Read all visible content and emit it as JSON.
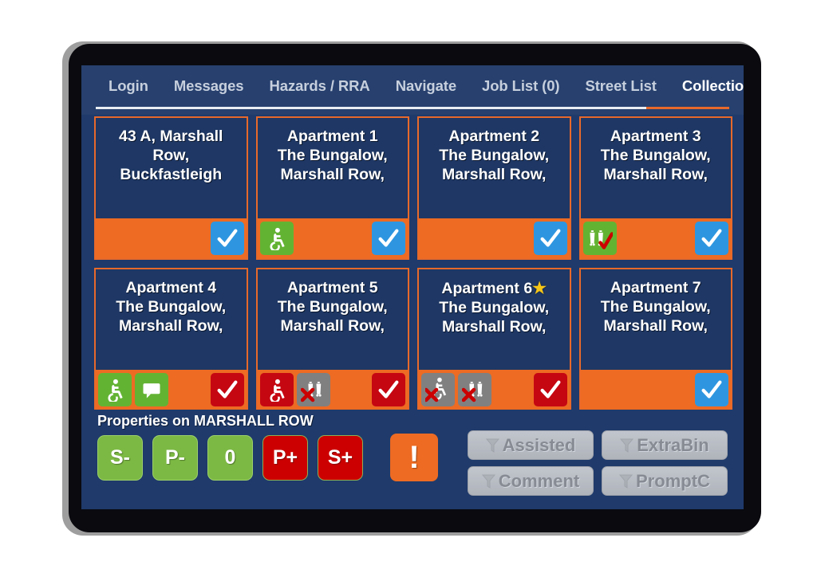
{
  "app": {
    "screen_name": "Collections"
  },
  "nav": {
    "tabs": [
      {
        "label": "Login",
        "active": false
      },
      {
        "label": "Messages",
        "active": false
      },
      {
        "label": "Hazards / RRA",
        "active": false
      },
      {
        "label": "Navigate",
        "active": false
      },
      {
        "label": "Job List (0)",
        "active": false
      },
      {
        "label": "Street List",
        "active": false
      },
      {
        "label": "Collections",
        "active": true
      }
    ]
  },
  "cards": [
    {
      "title": "43 A, Marshall\nRow,\nBuckfastleigh",
      "star": false,
      "icons": [],
      "check": {
        "name": "check-icon",
        "color": "blue"
      }
    },
    {
      "title": "Apartment 1\nThe Bungalow,\nMarshall Row,",
      "star": false,
      "icons": [
        {
          "name": "wheelchair-icon",
          "color": "green"
        }
      ],
      "check": {
        "name": "check-icon",
        "color": "blue"
      }
    },
    {
      "title": "Apartment 2\nThe Bungalow,\nMarshall Row,",
      "star": false,
      "icons": [],
      "check": {
        "name": "check-icon",
        "color": "blue"
      }
    },
    {
      "title": "Apartment 3\nThe Bungalow,\nMarshall Row,",
      "star": false,
      "icons": [
        {
          "name": "extra-bin-icon",
          "color": "green"
        }
      ],
      "check": {
        "name": "check-icon",
        "color": "blue"
      }
    },
    {
      "title": "Apartment 4\nThe Bungalow,\nMarshall Row,",
      "star": false,
      "icons": [
        {
          "name": "wheelchair-icon",
          "color": "green"
        },
        {
          "name": "comment-icon",
          "color": "green"
        }
      ],
      "check": {
        "name": "check-icon",
        "color": "red"
      }
    },
    {
      "title": "Apartment 5\nThe Bungalow,\nMarshall Row,",
      "star": false,
      "icons": [
        {
          "name": "wheelchair-icon",
          "color": "red"
        },
        {
          "name": "no-extra-bin-icon",
          "color": "grey"
        }
      ],
      "check": {
        "name": "check-icon",
        "color": "red"
      }
    },
    {
      "title": "Apartment 6\nThe Bungalow,\nMarshall Row,",
      "star": true,
      "star_name": "star-icon",
      "icons": [
        {
          "name": "no-wheelchair-icon",
          "color": "grey"
        },
        {
          "name": "no-extra-bin-icon",
          "color": "grey"
        }
      ],
      "check": {
        "name": "check-icon",
        "color": "red"
      }
    },
    {
      "title": "Apartment 7\nThe Bungalow,\nMarshall Row,",
      "star": false,
      "icons": [],
      "check": {
        "name": "check-icon",
        "color": "blue"
      }
    }
  ],
  "bottom": {
    "properties_label": "Properties on MARSHALL ROW",
    "pills": [
      {
        "label": "S-",
        "color": "green"
      },
      {
        "label": "P-",
        "color": "green"
      },
      {
        "label": "0",
        "color": "green"
      },
      {
        "label": "P+",
        "color": "red"
      },
      {
        "label": "S+",
        "color": "red"
      }
    ],
    "alert_label": "!",
    "filters": [
      {
        "label": "Assisted",
        "enabled": false
      },
      {
        "label": "ExtraBin",
        "enabled": false
      },
      {
        "label": "Comment",
        "enabled": false
      },
      {
        "label": "PromptC",
        "enabled": false
      }
    ]
  },
  "colors": {
    "orange": "#ED6B23",
    "navy_card": "#1E3764",
    "navy_page": "#1F3A6B",
    "navy_bar": "#27406E",
    "green": "#63B333",
    "red": "#C50712",
    "blue": "#2E96E0",
    "grey": "#808080",
    "star_yellow": "#F5C518"
  }
}
